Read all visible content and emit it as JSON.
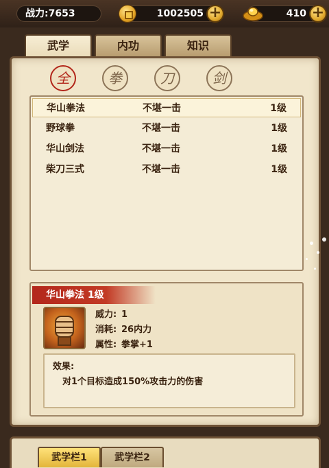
{
  "resources": {
    "power_label": "战力:7653",
    "gold": "1002505",
    "ingot": "410"
  },
  "tabs": [
    "武学",
    "内功",
    "知识"
  ],
  "filters": [
    "全",
    "拳",
    "刀",
    "剑"
  ],
  "skills": [
    {
      "name": "华山拳法",
      "desc": "不堪一击",
      "level": "1级"
    },
    {
      "name": "野球拳",
      "desc": "不堪一击",
      "level": "1级"
    },
    {
      "name": "华山剑法",
      "desc": "不堪一击",
      "level": "1级"
    },
    {
      "name": "柴刀三式",
      "desc": "不堪一击",
      "level": "1级"
    }
  ],
  "detail": {
    "title": "华山拳法 1级",
    "stats": [
      {
        "key": "威力:",
        "value": "1"
      },
      {
        "key": "消耗:",
        "value": "26内力"
      },
      {
        "key": "属性:",
        "value": "拳掌+1"
      }
    ],
    "effect_label": "效果:",
    "effect_text": "对1个目标造成150%攻击力的伤害"
  },
  "bottom_tabs": [
    "武学栏1",
    "武学栏2"
  ],
  "colors": {
    "accent_red": "#b2261a",
    "parchment": "#f1e6cb",
    "gold": "#e3a324"
  }
}
